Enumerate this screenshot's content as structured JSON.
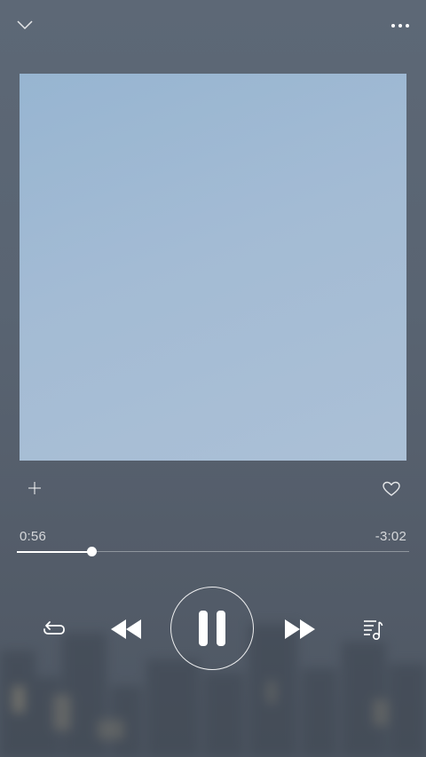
{
  "header": {
    "collapse_icon": "chevron-down-icon",
    "more_icon": "more-horizontal-icon"
  },
  "artwork": {
    "colors": [
      "#97b5d1",
      "#abc0d6"
    ]
  },
  "actions": {
    "add_icon": "plus-icon",
    "like_icon": "heart-outline-icon"
  },
  "playback": {
    "elapsed": "0:56",
    "remaining": "-3:02",
    "progress": 0.19
  },
  "controls": {
    "repeat_icon": "repeat-icon",
    "previous_icon": "rewind-icon",
    "play_pause_icon": "pause-icon",
    "next_icon": "fast-forward-icon",
    "queue_icon": "playlist-icon",
    "accent": "#ffffff"
  }
}
